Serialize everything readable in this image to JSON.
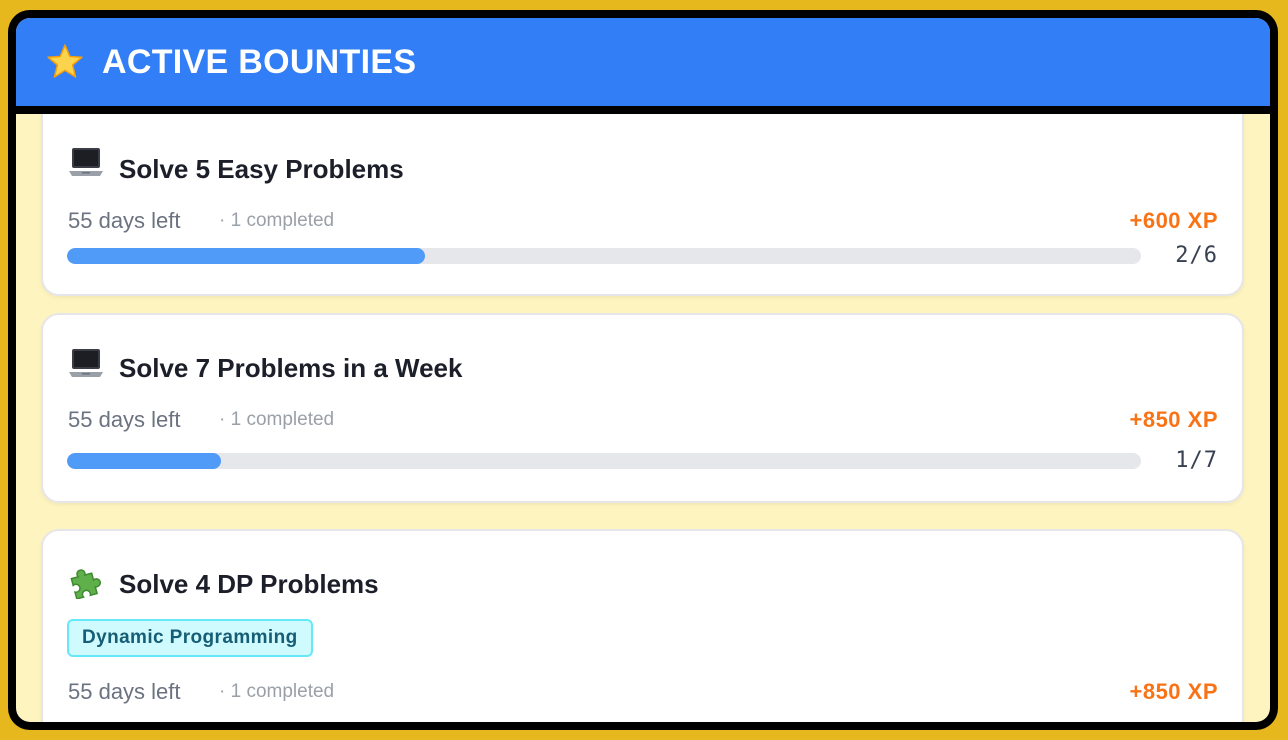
{
  "header": {
    "title": "ACTIVE BOUNTIES",
    "icon": "star-icon"
  },
  "bounties": [
    {
      "icon": "laptop-icon",
      "title": "Solve 5 Easy Problems",
      "days_left": "55 days left",
      "completed": "· 1 completed",
      "xp": "+600 XP",
      "progress_text": "2/6",
      "progress": 0.333
    },
    {
      "icon": "laptop-icon",
      "title": "Solve 7 Problems in a Week",
      "days_left": "55 days left",
      "completed": "· 1 completed",
      "xp": "+850 XP",
      "progress_text": "1/7",
      "progress": 0.143
    },
    {
      "icon": "puzzle-icon",
      "title": "Solve 4 DP Problems",
      "tag": "Dynamic Programming",
      "days_left": "55 days left",
      "completed": "· 1 completed",
      "xp": "+850 XP"
    }
  ],
  "colors": {
    "header": "#327ef6",
    "xp": "#f97316",
    "progress": "#4f9bf7",
    "background": "#fef4c0"
  }
}
